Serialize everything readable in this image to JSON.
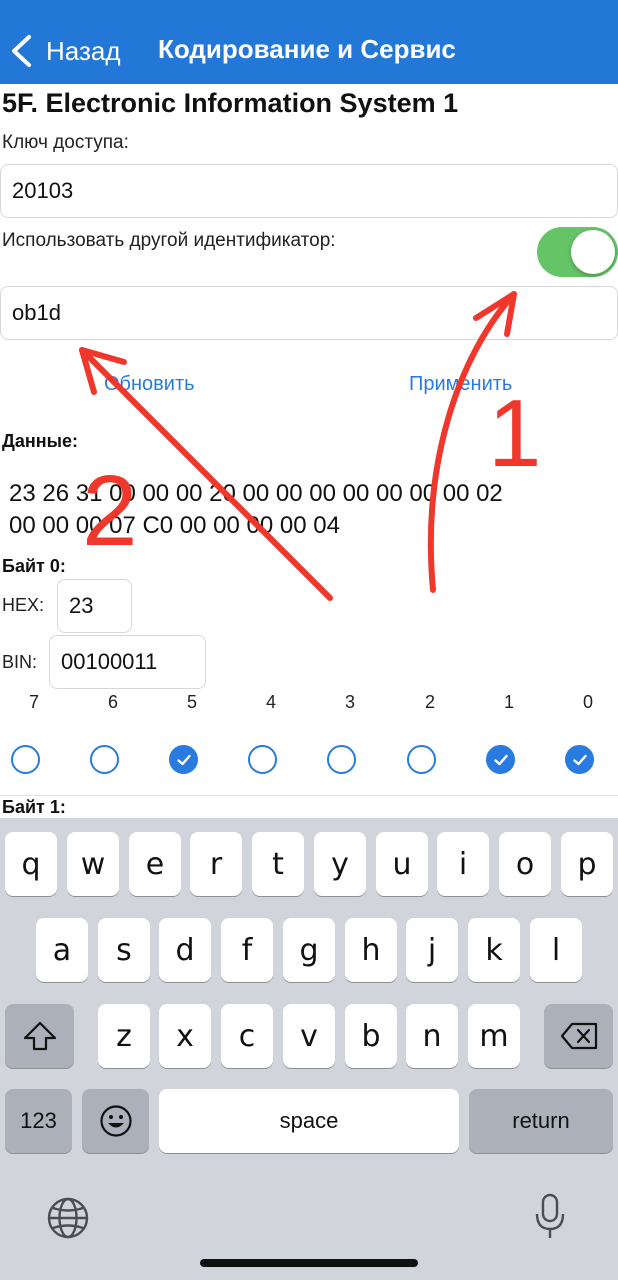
{
  "navbar": {
    "back_label": "Назад",
    "title": "Кодирование и Сервис"
  },
  "section": {
    "title": "5F. Electronic Information System 1"
  },
  "access_key": {
    "label": "Ключ доступа:",
    "value": "20103"
  },
  "other_id": {
    "label": "Использовать другой идентификатор:",
    "toggle_on": true,
    "value": "ob1d"
  },
  "actions": {
    "refresh_label": "Обновить",
    "apply_label": "Применить"
  },
  "data": {
    "label": "Данные:",
    "line1": "23 26 31 00 00 00 20 00 00 00 00 00 00 00 02",
    "line2": "00 00 00 07 C0 00 00 00 00 04"
  },
  "byte0": {
    "label": "Байт 0:",
    "hex_label": "HEX:",
    "hex_value": "23",
    "bin_label": "BIN:",
    "bin_value": "00100011",
    "bit_numbers": [
      "7",
      "6",
      "5",
      "4",
      "3",
      "2",
      "1",
      "0"
    ],
    "bits_checked": [
      false,
      false,
      true,
      false,
      false,
      false,
      true,
      true
    ]
  },
  "byte1": {
    "label": "Байт 1:"
  },
  "annotations": {
    "mark1": "1",
    "mark2": "2",
    "color": "#F0372C"
  },
  "keyboard": {
    "row1": [
      "q",
      "w",
      "e",
      "r",
      "t",
      "y",
      "u",
      "i",
      "o",
      "p"
    ],
    "row2": [
      "a",
      "s",
      "d",
      "f",
      "g",
      "h",
      "j",
      "k",
      "l"
    ],
    "row3": [
      "z",
      "x",
      "c",
      "v",
      "b",
      "n",
      "m"
    ],
    "numbers_label": "123",
    "space_label": "space",
    "return_label": "return",
    "icons": [
      "shift-icon",
      "backspace-icon",
      "emoji-icon",
      "globe-icon",
      "microphone-icon"
    ]
  },
  "colors": {
    "accent": "#2377D6",
    "toggle": "#64C466",
    "link": "#2A7BE0"
  }
}
